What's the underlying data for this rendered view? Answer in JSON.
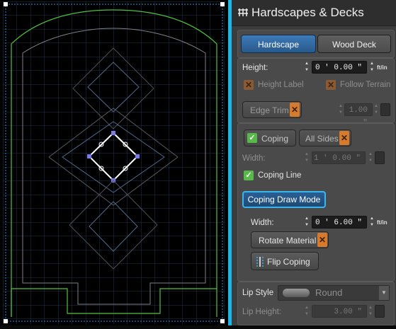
{
  "panel": {
    "title": "Hardscapes & Decks",
    "title_icon": "deck-icon",
    "tabs": [
      {
        "label": "Hardscape",
        "active": true
      },
      {
        "label": "Wood Deck",
        "active": false
      }
    ],
    "height_label": "Height:",
    "height_value": "0 ' 0.00 \"",
    "units": "ft/in",
    "height_label_toggle": "Height Label",
    "follow_terrain": "Follow Terrain",
    "edge_trim": "Edge Trim",
    "edge_trim_value": "1.00 \"",
    "coping": "Coping",
    "all_sides": "All Sides",
    "width_label": "Width:",
    "width_value_dim": "1 ' 0.00 \"",
    "coping_line": "Coping Line",
    "coping_draw_mode": "Coping Draw Mode",
    "width2_label": "Width:",
    "width2_value": "0 ' 6.00 \"",
    "rotate_material": "Rotate Material",
    "flip_coping": "Flip Coping",
    "lip_style_label": "Lip Style",
    "lip_style_value": "Round",
    "lip_height_label": "Lip Height:",
    "lip_height_value": "3.00 \""
  }
}
